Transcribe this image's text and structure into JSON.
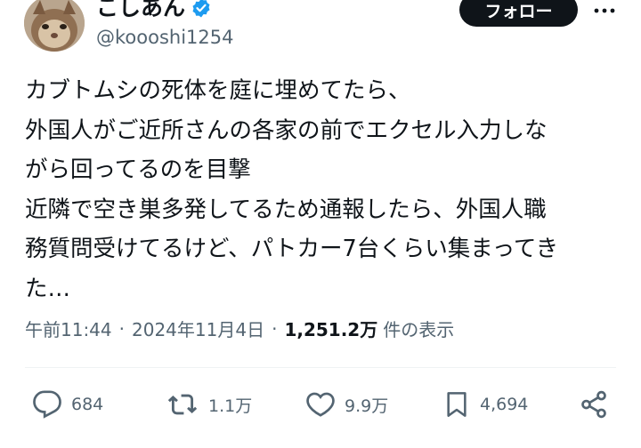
{
  "user": {
    "display_name": "こしあん",
    "handle": "@koooshi1254"
  },
  "header": {
    "follow_label": "フォロー"
  },
  "tweet": {
    "lines": [
      "カブトムシの死体を庭に埋めてたら、",
      "外国人がご近所さんの各家の前でエクセル入力しな",
      "がら回ってるのを目撃",
      "近隣で空き巣多発してるため通報したら、外国人職",
      "務質問受けてるけど、パトカー7台くらい集まってき",
      "た…"
    ]
  },
  "meta": {
    "time": "午前11:44",
    "dot1": "·",
    "date": "2024年11月4日",
    "dot2": "·",
    "views_count": "1,251.2万",
    "views_label": "件の表示"
  },
  "actions": {
    "replies": "684",
    "reposts": "1.1万",
    "likes": "9.9万",
    "bookmarks": "4,694"
  },
  "colors": {
    "text": "#0f1419",
    "muted": "#536471",
    "verified": "#1d9bf0",
    "follow_bg": "#0f1419"
  }
}
